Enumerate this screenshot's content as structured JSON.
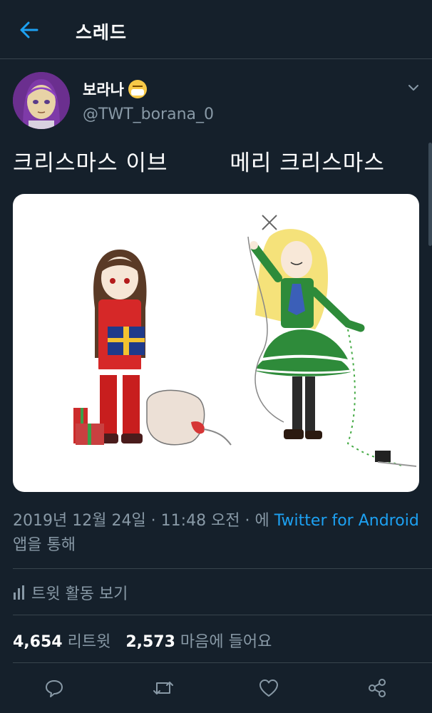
{
  "header": {
    "title": "스레드"
  },
  "tweet": {
    "display_name": "보라나",
    "handle": "@TWT_borana_0",
    "text_part1": "크리스마스 이브",
    "text_part2": "메리 크리스마스",
    "date": "2019년 12월 24일 · 11:48 오전 · 에 ",
    "source_link": "Twitter for Android",
    "source_suffix": " 앱을 통해",
    "activity_label": "트윗 활동 보기",
    "retweets_count": "4,654",
    "retweets_label": "리트윗",
    "likes_count": "2,573",
    "likes_label": "마음에 들어요"
  },
  "icons": {
    "back": "arrow-left-icon",
    "more": "chevron-down-icon",
    "activity": "bar-chart-icon",
    "reply": "speech-bubble-icon",
    "retweet": "retweet-icon",
    "like": "heart-icon",
    "share": "share-icon"
  },
  "colors": {
    "background": "#15202b",
    "accent": "#1da1f2",
    "muted": "#8899a6",
    "divider": "#38444d"
  }
}
